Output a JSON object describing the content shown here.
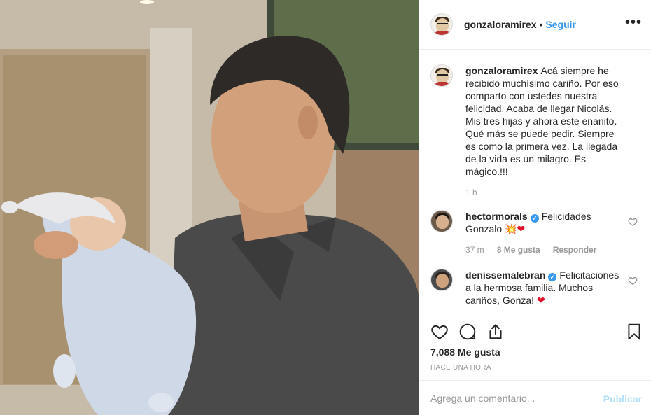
{
  "post": {
    "username": "gonzaloramirex",
    "follow_separator": "•",
    "follow_label": "Seguir",
    "more_icon": "more-horizontal-icon",
    "caption_username": "gonzaloramirex",
    "caption": "Acá siempre he recibido muchísimo cariño. Por eso comparto con ustedes nuestra felicidad. Acaba de llegar Nicolás. Mis tres hijas y ahora este enanito. Qué más se puede pedir. Siempre es como la primera vez. La llegada de la vida es un milagro. Es mágico.!!!",
    "caption_time": "1 h"
  },
  "comments": [
    {
      "username": "hectormorals",
      "verified": true,
      "text": "Felicidades Gonzalo",
      "emojis": "💥",
      "heart": "❤",
      "time": "37 m",
      "likes": "8 Me gusta",
      "reply": "Responder"
    },
    {
      "username": "denissemalebran",
      "verified": true,
      "text": "Felicitaciones a la hermosa familia. Muchos cariños, Gonza!",
      "heart": "❤"
    }
  ],
  "actions": {
    "like_icon": "heart-icon",
    "comment_icon": "comment-icon",
    "share_icon": "share-icon",
    "save_icon": "bookmark-icon",
    "likes": "7,088 Me gusta",
    "timestamp": "HACE UNA HORA"
  },
  "add_comment": {
    "placeholder": "Agrega un comentario...",
    "post_label": "Publicar"
  },
  "colors": {
    "accent": "#3897f0",
    "text": "#262626",
    "muted": "#999999",
    "border": "#efefef",
    "publish_disabled": "#b2dffc",
    "heart": "#e0102b"
  }
}
